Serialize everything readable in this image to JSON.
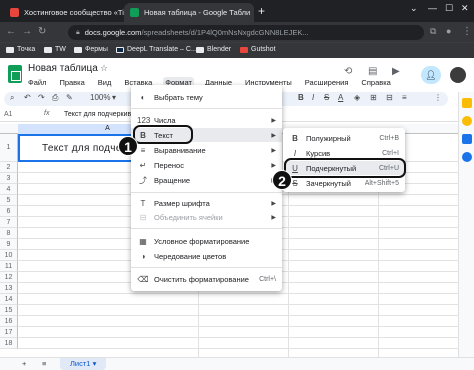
{
  "browser": {
    "tabs": [
      {
        "title": "Хостинговое сообщество «Tim",
        "favicon_color": "#e8453c"
      },
      {
        "title": "Новая таблица - Google Табли",
        "favicon_color": "#0f9d58"
      }
    ],
    "new_tab": "+",
    "url_domain": "docs.google.com",
    "url_path": "/spreadsheets/d/1P4lQ0mNsNxgdcGNN8LEJEK...",
    "bookmarks": [
      "Точка",
      "TW",
      "Фермы",
      "DeepL Translate – C...",
      "Blender",
      "Gutshot"
    ]
  },
  "sheets": {
    "doc_title": "Новая таблица",
    "menu": [
      "Файл",
      "Правка",
      "Вид",
      "Вставка",
      "Формат",
      "Данные",
      "Инструменты",
      "Расширения",
      "Справка"
    ],
    "active_menu": "Формат",
    "zoom": "100%",
    "cell_ref": "A1",
    "formula": "Текст для подчеркивания",
    "column_a": "A",
    "cell_a1": "Текст для подчерк",
    "rows": [
      "1",
      "2",
      "3",
      "4",
      "5",
      "6",
      "7",
      "8",
      "9",
      "10",
      "11",
      "12",
      "13",
      "14",
      "15",
      "16",
      "17",
      "18"
    ],
    "add_sheet": "+",
    "sheet_list": "≡",
    "sheet_tab": "Лист1"
  },
  "format_menu": {
    "theme": "Выбрать тему",
    "numbers": "Числа",
    "text": "Текст",
    "alignment": "Выравнивание",
    "wrapping": "Перенос",
    "rotation": "Вращение",
    "font_size": "Размер шрифта",
    "merge_cells": "Объединить ячейки",
    "conditional": "Условное форматирование",
    "alternating": "Чередование цветов",
    "clear": "Очистить форматирование",
    "clear_shortcut": "Ctrl+\\"
  },
  "text_submenu": {
    "bold": "Полужирный",
    "bold_shortcut": "Ctrl+B",
    "italic": "Курсив",
    "italic_shortcut": "Ctrl+I",
    "underline": "Подчеркнутый",
    "underline_shortcut": "Ctrl+U",
    "strike": "Зачеркнутый",
    "strike_shortcut": "Alt+Shift+5"
  },
  "annotations": {
    "step1": "1",
    "step2": "2"
  }
}
